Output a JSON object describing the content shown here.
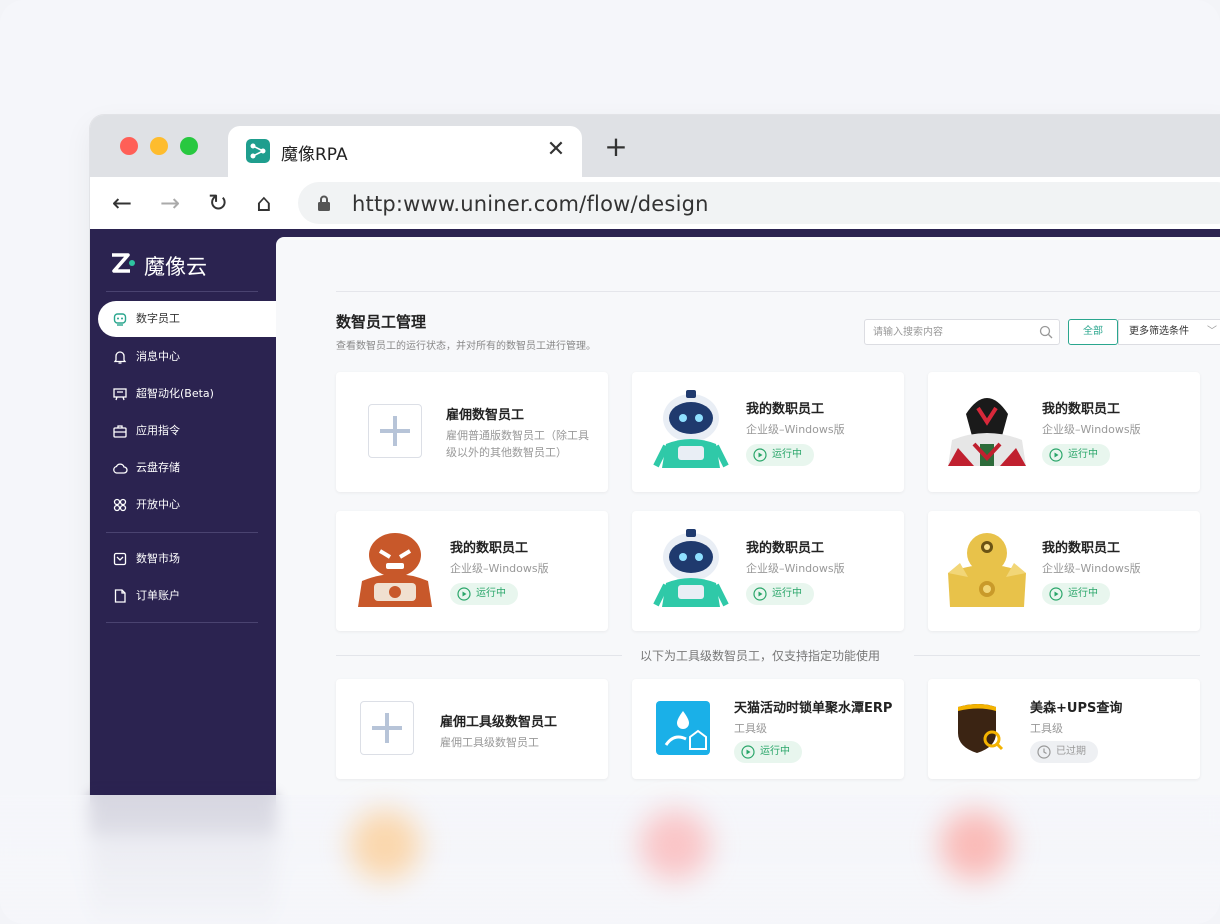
{
  "browser": {
    "tab_title": "魔像RPA",
    "close_glyph": "✕",
    "new_tab_glyph": "+",
    "back_glyph": "←",
    "forward_glyph": "→",
    "reload_glyph": "↻",
    "home_glyph": "⌂",
    "url": "http:www.uniner.com/flow/design"
  },
  "sidebar": {
    "brand": "魔像云",
    "items": [
      {
        "label": "数字员工",
        "icon": "robot-icon",
        "active": true
      },
      {
        "label": "消息中心",
        "icon": "bell-icon"
      },
      {
        "label": "超智动化(Beta)",
        "icon": "automation-icon"
      },
      {
        "label": "应用指令",
        "icon": "briefcase-icon"
      },
      {
        "label": "云盘存储",
        "icon": "cloud-icon"
      },
      {
        "label": "开放中心",
        "icon": "open-center-icon"
      },
      {
        "label": "数智市场",
        "icon": "market-icon"
      },
      {
        "label": "订单账户",
        "icon": "order-icon"
      }
    ]
  },
  "main": {
    "title": "数智员工管理",
    "subtitle": "查看数智员工的运行状态，并对所有的数智员工进行管理。",
    "search_placeholder": "请输入搜索内容",
    "filter_all": "全部",
    "filter_more": "更多筛选条件",
    "filter_chevron": "﹀",
    "hire_card": {
      "title": "雇佣数智员工",
      "desc": "雇佣普通版数智员工（除工具级以外的其他数智员工）"
    },
    "employees": [
      {
        "title": "我的数职员工",
        "sub": "企业级–Windows版",
        "status": "运行中",
        "robot": "blue"
      },
      {
        "title": "我的数职员工",
        "sub": "企业级–Windows版",
        "status": "运行中",
        "robot": "red"
      },
      {
        "title": "我的数职员工",
        "sub": "企业级–Windows版",
        "status": "运行中",
        "robot": "orange"
      },
      {
        "title": "我的数职员工",
        "sub": "企业级–Windows版",
        "status": "运行中",
        "robot": "blue"
      },
      {
        "title": "我的数职员工",
        "sub": "企业级–Windows版",
        "status": "运行中",
        "robot": "gold"
      }
    ],
    "divider_text": "以下为工具级数智员工，仅支持指定功能使用",
    "tool_hire_card": {
      "title": "雇佣工具级数智员工",
      "desc": "雇佣工具级数智员工"
    },
    "tools": [
      {
        "title": "天猫活动时锁单聚水潭ERP",
        "sub": "工具级",
        "status": "运行中",
        "state": "running"
      },
      {
        "title": "美森+UPS查询",
        "sub": "工具级",
        "status": "已过期",
        "state": "expired"
      }
    ]
  },
  "colors": {
    "sidebar_bg": "#2b2350",
    "accent": "#2aa68e",
    "running": "#2aa66a"
  }
}
